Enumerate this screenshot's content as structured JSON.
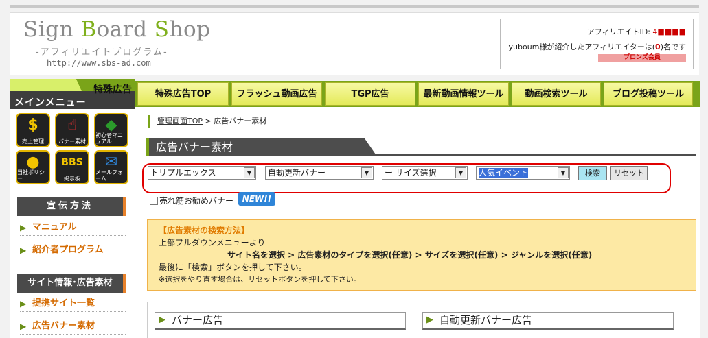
{
  "header": {
    "logo_title_grey1": "Sign ",
    "logo_title_green1": "B",
    "logo_title_grey2": "oard ",
    "logo_title_green2": "S",
    "logo_title_grey3": "hop",
    "logo_subtitle": "-アフィリエイトプログラム-",
    "logo_url": "http://www.sbs-ad.com",
    "affiliate_id_label": "アフィリエイトID: ",
    "affiliate_id_value": "4■■■■",
    "intro_text_pre": "yuboum様が紹介したアフィリエイターは(",
    "intro_count": "0",
    "intro_text_post": ")名です",
    "rank_badge": "ブロンズ会員"
  },
  "sidebar": {
    "tokushu_label": "特殊広告",
    "menu_title": "メインメニュー",
    "icons": [
      {
        "icon": "dollar-icon",
        "glyph": "$",
        "label": "売上管理",
        "color": "#f2c400"
      },
      {
        "icon": "hand-pointer-icon",
        "glyph": "☝",
        "label": "バナー素材",
        "color": "#d83030"
      },
      {
        "icon": "beginner-icon",
        "glyph": "◆",
        "label": "初心者マニュアル",
        "color": "#2b9b2b"
      },
      {
        "icon": "policy-icon",
        "glyph": "●",
        "label": "当社ポリシー",
        "color": "#f2c400"
      },
      {
        "icon": "bbs-icon",
        "glyph": "BBS",
        "label": "掲示板",
        "color": "#f2c400"
      },
      {
        "icon": "mail-icon",
        "glyph": "✉",
        "label": "メールフォーム",
        "color": "#2f85d8"
      }
    ],
    "section1_title": "宣伝方法",
    "section1_links": [
      "マニュアル",
      "紹介者プログラム"
    ],
    "section2_title": "サイト情報･広告素材",
    "section2_links": [
      "提携サイト一覧",
      "広告バナー素材"
    ]
  },
  "nav": {
    "items": [
      "特殊広告TOP",
      "フラッシュ動画広告",
      "TGP広告",
      "最新動画情報ツール",
      "動画検索ツール",
      "ブログ投稿ツール"
    ]
  },
  "main": {
    "breadcrumb_link": "管理画面TOP",
    "breadcrumb_sep": " > ",
    "breadcrumb_current": "広告バナー素材",
    "page_title": "広告バナー素材",
    "filters": {
      "site": "トリプルエックス",
      "type": "自動更新バナー",
      "size": "ー サイズ選択 --",
      "genre": "人気イベント"
    },
    "search_button": "検索",
    "reset_button": "リセット",
    "recommend_checkbox_label": "売れ筋お勧めバナー",
    "new_badge": "NEW!!",
    "howto": {
      "heading": "【広告素材の検索方法】",
      "line1": "上部プルダウンメニューより",
      "line2": "サイト名を選択 > 広告素材のタイプを選択(任意) > サイズを選択(任意) > ジャンルを選択(任意)",
      "line3": "最後に「検索」ボタンを押して下さい。",
      "line4": "※選択をやり直す場合は、リセットボタンを押して下さい。"
    },
    "panels": [
      "バナー広告",
      "自動更新バナー広告"
    ]
  },
  "colors": {
    "accent_green": "#7aa419",
    "link_orange": "#d46a00",
    "highlight_red": "#e00000"
  }
}
